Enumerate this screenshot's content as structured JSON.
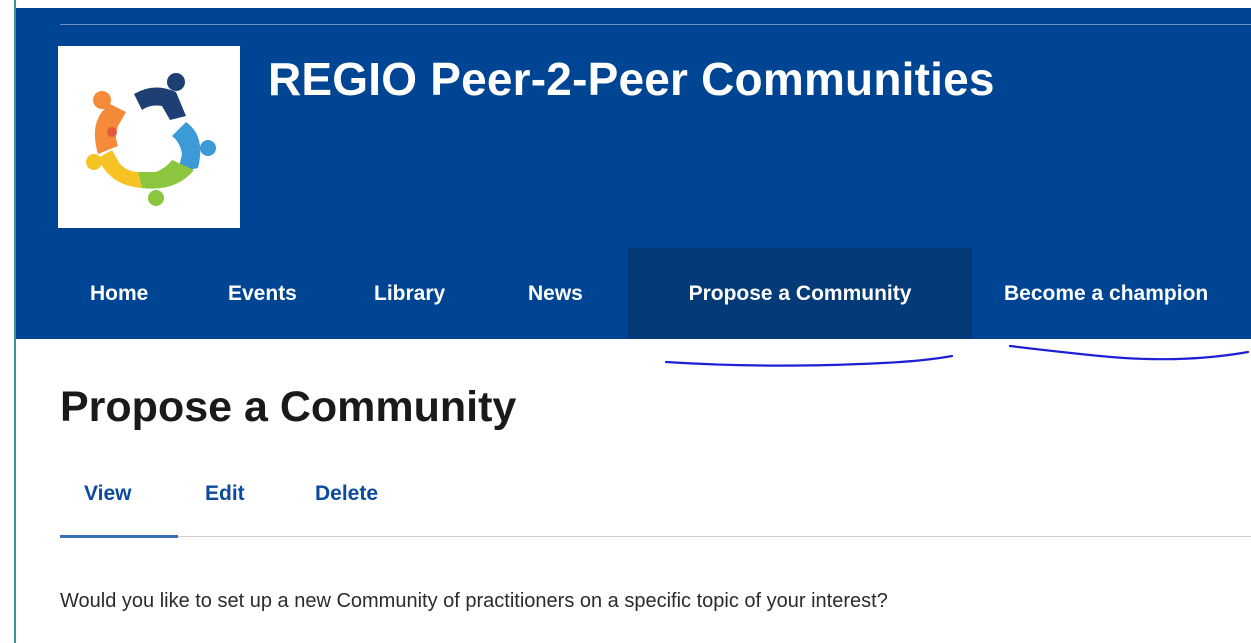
{
  "site": {
    "title": "REGIO Peer-2-Peer Communities"
  },
  "nav": {
    "items": [
      {
        "label": "Home"
      },
      {
        "label": "Events"
      },
      {
        "label": "Library"
      },
      {
        "label": "News"
      },
      {
        "label": "Propose a Community",
        "active": true
      },
      {
        "label": "Become a champion"
      }
    ]
  },
  "page": {
    "title": "Propose a Community",
    "tabs": [
      {
        "label": "View",
        "active": true
      },
      {
        "label": "Edit"
      },
      {
        "label": "Delete"
      }
    ],
    "intro": "Would you like to set up a new Community of practitioners on a specific topic of your interest?"
  },
  "colors": {
    "header_bg": "#004494",
    "active_nav_bg": "#053a78",
    "tab_link": "#0b4a9c",
    "annotation_ink": "#1f1fd6"
  },
  "icons": [
    "community-logo-icon"
  ]
}
